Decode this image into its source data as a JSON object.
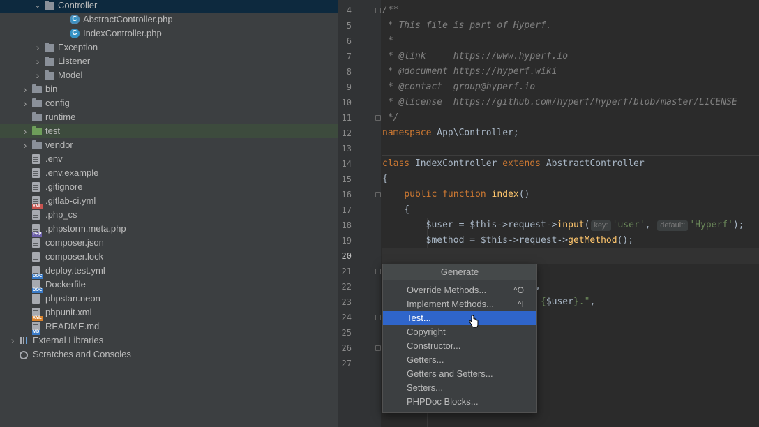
{
  "tree": [
    {
      "label": "Controller",
      "indent": 3,
      "icon": "folder",
      "expanded": true,
      "selected": "blue"
    },
    {
      "label": "AbstractController.php",
      "indent": 5,
      "icon": "php-abstract-class"
    },
    {
      "label": "IndexController.php",
      "indent": 5,
      "icon": "php-class"
    },
    {
      "label": "Exception",
      "indent": 3,
      "icon": "folder",
      "collapsed": true
    },
    {
      "label": "Listener",
      "indent": 3,
      "icon": "folder",
      "collapsed": true
    },
    {
      "label": "Model",
      "indent": 3,
      "icon": "folder",
      "collapsed": true
    },
    {
      "label": "bin",
      "indent": 2,
      "icon": "folder",
      "collapsed": true
    },
    {
      "label": "config",
      "indent": 2,
      "icon": "folder",
      "collapsed": true
    },
    {
      "label": "runtime",
      "indent": 2,
      "icon": "folder"
    },
    {
      "label": "test",
      "indent": 2,
      "icon": "folder-green",
      "collapsed": true,
      "selected": "green"
    },
    {
      "label": "vendor",
      "indent": 2,
      "icon": "folder",
      "collapsed": true
    },
    {
      "label": ".env",
      "indent": 2,
      "icon": "file"
    },
    {
      "label": ".env.example",
      "indent": 2,
      "icon": "file"
    },
    {
      "label": ".gitignore",
      "indent": 2,
      "icon": "file"
    },
    {
      "label": ".gitlab-ci.yml",
      "indent": 2,
      "icon": "file",
      "badge": "YML",
      "badge_color": "#c75450"
    },
    {
      "label": ".php_cs",
      "indent": 2,
      "icon": "file"
    },
    {
      "label": ".phpstorm.meta.php",
      "indent": 2,
      "icon": "file",
      "badge": "PHP",
      "badge_color": "#6b5fa8"
    },
    {
      "label": "composer.json",
      "indent": 2,
      "icon": "file"
    },
    {
      "label": "composer.lock",
      "indent": 2,
      "icon": "file"
    },
    {
      "label": "deploy.test.yml",
      "indent": 2,
      "icon": "file",
      "badge": "DOC",
      "badge_color": "#3a7bc8"
    },
    {
      "label": "Dockerfile",
      "indent": 2,
      "icon": "file",
      "badge": "DOC",
      "badge_color": "#3a7bc8"
    },
    {
      "label": "phpstan.neon",
      "indent": 2,
      "icon": "file"
    },
    {
      "label": "phpunit.xml",
      "indent": 2,
      "icon": "file",
      "badge": "XML",
      "badge_color": "#d9822b"
    },
    {
      "label": "README.md",
      "indent": 2,
      "icon": "file",
      "badge": "MD",
      "badge_color": "#3a7bc8"
    },
    {
      "label": "External Libraries",
      "indent": 1,
      "icon": "libraries",
      "collapsed": true
    },
    {
      "label": "Scratches and Consoles",
      "indent": 1,
      "icon": "scratches"
    }
  ],
  "editor": {
    "lines": [
      {
        "n": "4",
        "html": "<span class='cm'>/**</span>",
        "fold": true
      },
      {
        "n": "5",
        "html": "<span class='cm'> * This file is part of Hyperf.</span>"
      },
      {
        "n": "6",
        "html": "<span class='cm'> *</span>"
      },
      {
        "n": "7",
        "html": "<span class='cm'> * @link     https://www.hyperf.io</span>"
      },
      {
        "n": "8",
        "html": "<span class='cm'> * @document https://hyperf.wiki</span>"
      },
      {
        "n": "9",
        "html": "<span class='cm'> * @contact  group@hyperf.io</span>"
      },
      {
        "n": "10",
        "html": "<span class='cm'> * @license  https://github.com/hyperf/hyperf/blob/master/LICENSE</span>"
      },
      {
        "n": "11",
        "html": "<span class='cm'> */</span>",
        "fold": true
      },
      {
        "n": "12",
        "html": "<span class='kw'>namespace</span> App\\Controller;"
      },
      {
        "n": "13",
        "html": ""
      },
      {
        "n": "14",
        "html": "<span class='kw'>class</span> IndexController <span class='kw'>extends</span> AbstractController"
      },
      {
        "n": "15",
        "html": "{"
      },
      {
        "n": "16",
        "html": "    <span class='kw'>public function</span> <span class='fn'>index</span>()",
        "fold": true
      },
      {
        "n": "17",
        "html": "    {"
      },
      {
        "n": "18",
        "html": "        $user = $this-><span class='var'>request</span>-><span class='fn'>input</span>(<span class='hint'>key:</span><span class='str'>'user'</span>, <span class='hint'>default:</span><span class='str'>'Hyperf'</span>);"
      },
      {
        "n": "19",
        "html": "        $method = $this-><span class='var'>request</span>-><span class='fn'>getMethod</span>();"
      },
      {
        "n": "20",
        "html": "",
        "current": true
      },
      {
        "n": "21",
        "html": "",
        "fold": true
      },
      {
        "n": "22",
        "html": "                        thod,"
      },
      {
        "n": "23",
        "html": "                        <span class='str'>ello {</span>$user<span class='str'>}.\"</span>,"
      },
      {
        "n": "24",
        "html": "",
        "fold": true
      },
      {
        "n": "25",
        "html": ""
      },
      {
        "n": "26",
        "html": "",
        "fold": true
      },
      {
        "n": "27",
        "html": ""
      }
    ]
  },
  "popup": {
    "title": "Generate",
    "items": [
      {
        "label": "Override Methods...",
        "shortcut": "^O"
      },
      {
        "label": "Implement Methods...",
        "shortcut": "^I"
      },
      {
        "label": "Test...",
        "selected": true
      },
      {
        "label": "Copyright"
      },
      {
        "label": "Constructor..."
      },
      {
        "label": "Getters..."
      },
      {
        "label": "Getters and Setters..."
      },
      {
        "label": "Setters..."
      },
      {
        "label": "PHPDoc Blocks..."
      }
    ]
  }
}
